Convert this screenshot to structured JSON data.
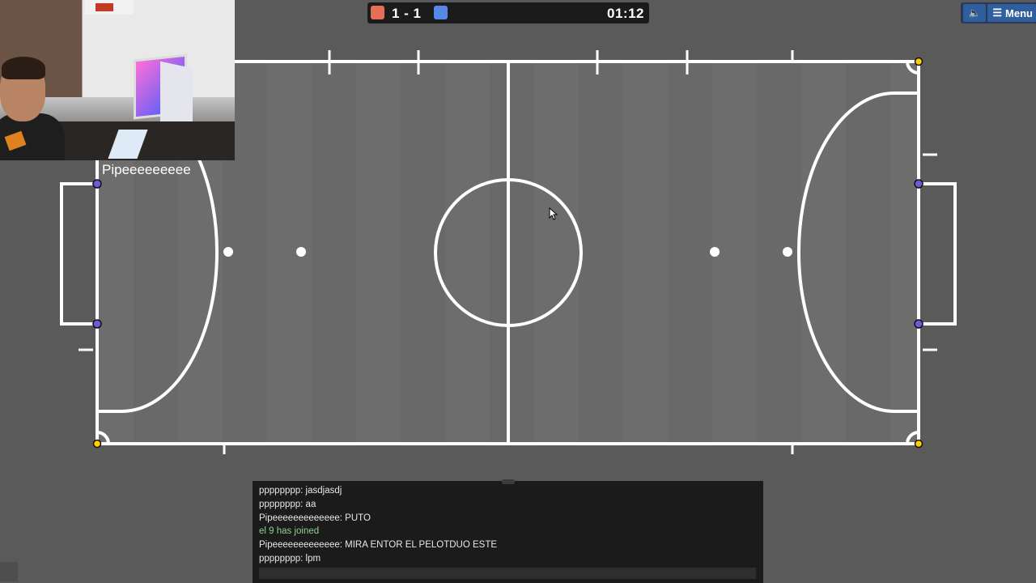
{
  "scoreboard": {
    "red_color": "#e56e56",
    "blue_color": "#5689e5",
    "score": "1 - 1",
    "time": "01:12"
  },
  "controls": {
    "sound_icon": "speaker-icon",
    "sound_glyph": "🔈",
    "menu_icon": "hamburger-icon",
    "menu_glyph": "☰",
    "menu_label": "Menu"
  },
  "field": {
    "background_color": "#6b6b6b",
    "line_color": "#ffffff",
    "post_color_blue_team": "#6a5cd6",
    "corner_color": "#ffcc00"
  },
  "player": {
    "name": "Pipeeeeeeeeeeee"
  },
  "chat": {
    "messages": [
      {
        "text": "pppppppp: jasdjasdj",
        "type": "message"
      },
      {
        "text": "pppppppp: aa",
        "type": "message"
      },
      {
        "text": "Pipeeeeeeeeeeeee: PUTO",
        "type": "message"
      },
      {
        "text": "el 9 has joined",
        "type": "notice"
      },
      {
        "text": "Pipeeeeeeeeeeeee: MIRA ENTOR EL PELOTDUO ESTE",
        "type": "message"
      },
      {
        "text": "pppppppp: lpm",
        "type": "message"
      }
    ],
    "input_value": "",
    "input_placeholder": ""
  }
}
